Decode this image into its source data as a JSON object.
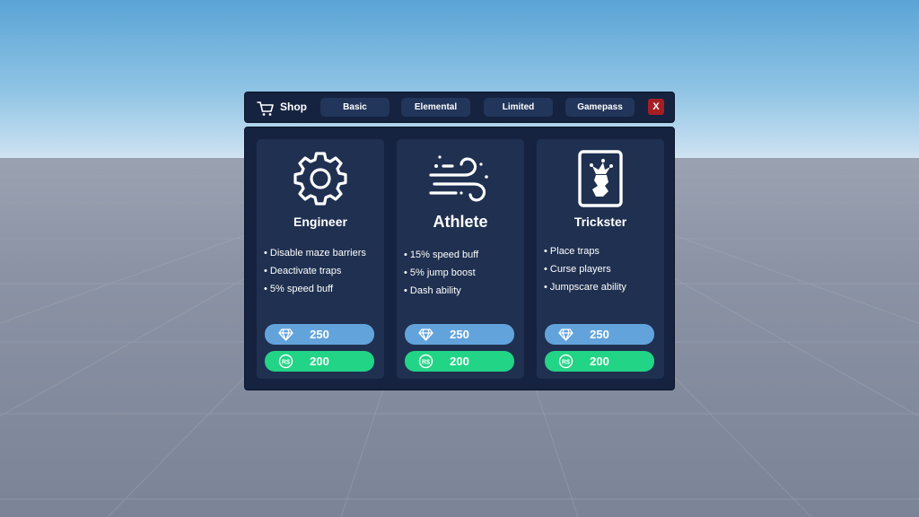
{
  "topbar": {
    "title": "Shop",
    "tabs": [
      {
        "label": "Basic"
      },
      {
        "label": "Elemental"
      },
      {
        "label": "Limited"
      },
      {
        "label": "Gamepass"
      }
    ],
    "close_label": "X"
  },
  "cards": [
    {
      "name": "Engineer",
      "icon": "gear-icon",
      "perks": [
        "• Disable maze barriers",
        "• Deactivate traps",
        "• 5% speed buff"
      ],
      "gem_price": "250",
      "robux_price": "200"
    },
    {
      "name": "Athlete",
      "icon": "wind-icon",
      "perks": [
        "• 15% speed buff",
        "• 5% jump boost",
        "• Dash ability"
      ],
      "gem_price": "250",
      "robux_price": "200"
    },
    {
      "name": "Trickster",
      "icon": "jester-card-icon",
      "perks": [
        "• Place traps",
        "• Curse players",
        "• Jumpscare ability"
      ],
      "gem_price": "250",
      "robux_price": "200"
    }
  ],
  "colors": {
    "panel": "#152340",
    "card": "#1f3050",
    "tab": "#22355a",
    "gem_button": "#63a3db",
    "robux_button": "#22d486",
    "close_button": "#a61e24"
  }
}
